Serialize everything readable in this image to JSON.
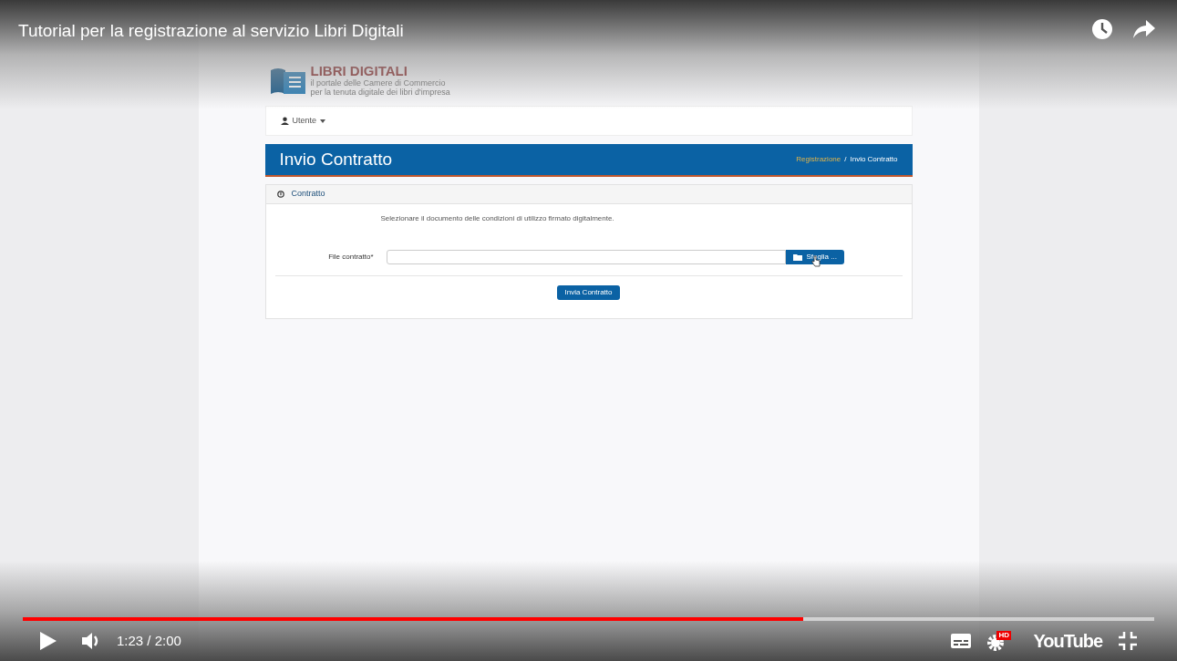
{
  "player": {
    "title": "Tutorial per la registrazione al servizio Libri Digitali",
    "progress": {
      "level": 0.69
    },
    "time": "1:23 / 2:00",
    "quality_badge": "HD",
    "logo": "YouTube"
  },
  "page": {
    "brand": {
      "name": "LIBRI DIGITALI",
      "tagline_1": "il portale delle Camere di Commercio",
      "tagline_2": "per la tenuta digitale dei libri d'impresa"
    },
    "user_menu": "Utente",
    "header": {
      "title": "Invio Contratto",
      "separator": "/",
      "breadcrumb": [
        {
          "label": "Registrazione",
          "kind": "link"
        },
        {
          "label": "Invio Contratto",
          "kind": "current"
        }
      ]
    },
    "panel": {
      "title": "Contratto",
      "instruction": "Selezionare il documento delle condizioni di utilizzo firmato digitalmente.",
      "field_label": "File contratto*",
      "browse_button": "Sfoglia ...",
      "submit_button": "Invia Contratto"
    }
  }
}
